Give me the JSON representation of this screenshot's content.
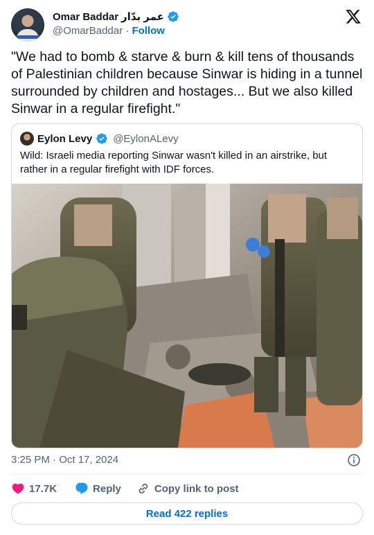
{
  "author": {
    "name": "Omar Baddar",
    "name_arabic": "عمر بدّار",
    "handle": "@OmarBaddar",
    "separator": "·",
    "follow_label": "Follow"
  },
  "tweet": {
    "text": "\"We had to bomb & starve & burn & kill tens of thousands of Palestinian children because Sinwar is hiding in a tunnel surrounded by children and hostages...  But we also killed Sinwar in a regular firefight.\""
  },
  "quoted": {
    "name": "Eylon Levy",
    "handle": "@EylonALevy",
    "text": "Wild: Israeli media reporting Sinwar wasn't killed in an airstrike, but rather in a regular firefight with IDF forces."
  },
  "timestamp": "3:25 PM · Oct 17, 2024",
  "actions": {
    "like_count": "17.7K",
    "reply_label": "Reply",
    "copy_label": "Copy link to post"
  },
  "read_replies_label": "Read 422 replies",
  "colors": {
    "accent": "#006fd6",
    "verified": "#1d9bf0",
    "like": "#f91880",
    "muted": "#536471",
    "border": "#cfd9de"
  },
  "icons": [
    "x-logo-icon",
    "verified-badge-icon",
    "info-icon",
    "heart-icon",
    "reply-bubble-icon",
    "link-icon"
  ]
}
